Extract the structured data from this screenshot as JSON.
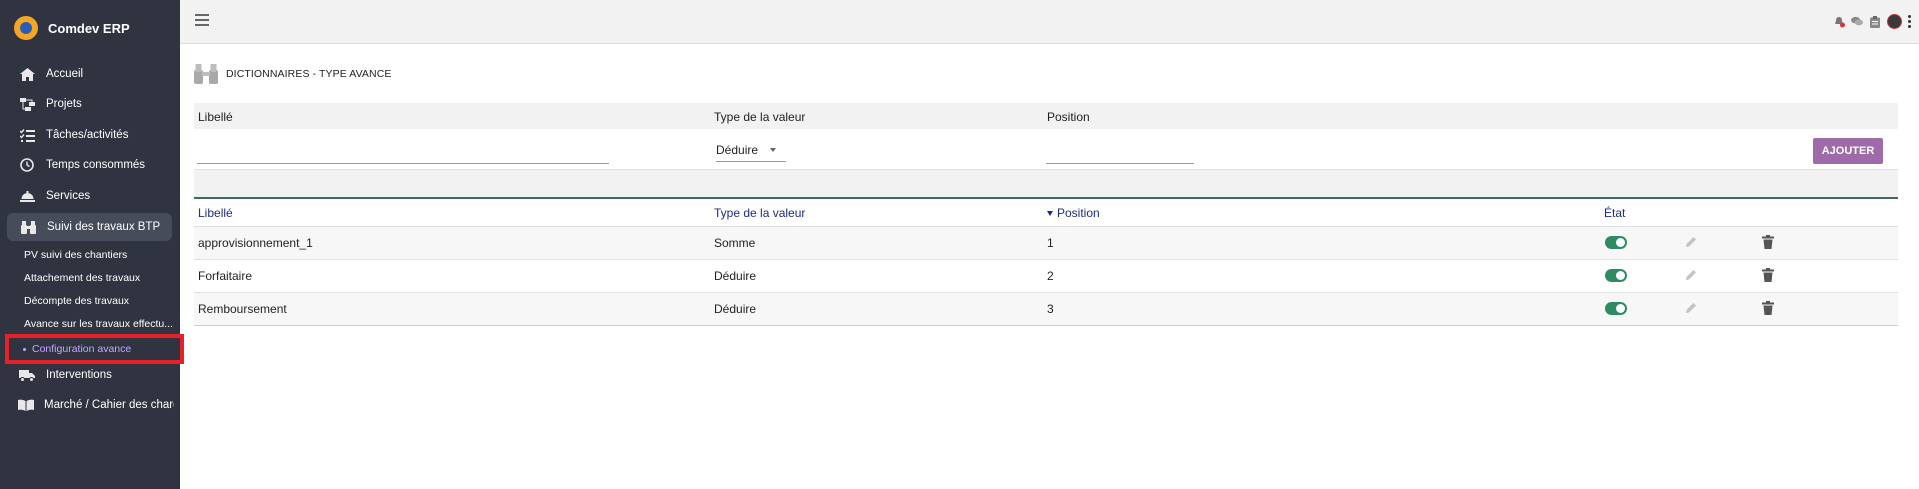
{
  "app": {
    "name": "Comdev ERP"
  },
  "sidebar": {
    "items": [
      {
        "label": "Accueil",
        "icon": "home-icon"
      },
      {
        "label": "Projets",
        "icon": "project-tree-icon"
      },
      {
        "label": "Tâches/activités",
        "icon": "task-list-icon"
      },
      {
        "label": "Temps consommés",
        "icon": "clock-icon"
      },
      {
        "label": "Services",
        "icon": "service-bell-icon"
      },
      {
        "label": "Suivi des travaux BTP",
        "icon": "binoculars-icon",
        "active": true
      },
      {
        "label": "Interventions",
        "icon": "truck-icon"
      },
      {
        "label": "Marché / Cahier des charg",
        "icon": "book-icon"
      }
    ],
    "subitems": [
      {
        "label": "PV suivi des chantiers"
      },
      {
        "label": "Attachement des travaux"
      },
      {
        "label": "Décompte des travaux"
      },
      {
        "label": "Avance sur les travaux effectu..."
      },
      {
        "label": "Configuration avance",
        "current": true
      }
    ]
  },
  "topbar": {
    "icons": [
      "notification-icon",
      "chat-icon",
      "clipboard-icon",
      "user-avatar",
      "more-vert-icon"
    ]
  },
  "page": {
    "title": "DICTIONNAIRES - TYPE AVANCE",
    "header_icon": "binoculars-icon"
  },
  "form": {
    "labels": {
      "libelle": "Libellé",
      "type": "Type de la valeur",
      "position": "Position"
    },
    "libelle_value": "",
    "type_value": "Déduire",
    "position_value": "",
    "add_label": "AJOUTER",
    "accent": "#9e6aa8"
  },
  "table": {
    "headers": {
      "libelle": "Libellé",
      "type": "Type de la valeur",
      "position": "Position",
      "etat": "État"
    },
    "sort": {
      "column": "position",
      "direction": "desc"
    },
    "rows": [
      {
        "libelle": "approvisionnement_1",
        "type": "Somme",
        "position": "1",
        "etat": true
      },
      {
        "libelle": "Forfaitaire",
        "type": "Déduire",
        "position": "2",
        "etat": true
      },
      {
        "libelle": "Remboursement",
        "type": "Déduire",
        "position": "3",
        "etat": true
      }
    ],
    "colors": {
      "header_text": "#1f2b80",
      "toggle_on": "#2e8b62",
      "border_top": "#3c6e57"
    }
  }
}
